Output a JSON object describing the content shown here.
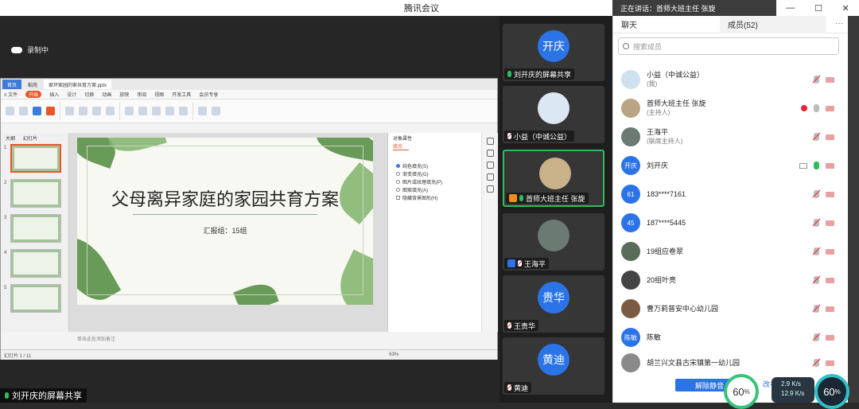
{
  "app_title": "腾讯会议",
  "recording": {
    "label": "录制中"
  },
  "share_label": "刘开庆的屏幕共享",
  "wps": {
    "tabs": [
      "首页",
      "稻壳",
      "家环家园的家共育方案.pptx"
    ],
    "menu": [
      "≡ 文件",
      "开始",
      "插入",
      "设计",
      "切换",
      "动画",
      "放映",
      "审阅",
      "视图",
      "开发工具",
      "会员专享"
    ],
    "outline_tabs": [
      "大纲",
      "幻灯片"
    ],
    "slide_title": "父母离异家庭的家园共育方案",
    "slide_sub": "汇报组：15组",
    "note_placeholder": "单击此处添加备注",
    "panel_title": "对象属性",
    "panel_tab": "填充",
    "panel_options": [
      "纯色填充(S)",
      "渐变填充(G)",
      "图片或纹理填充(P)",
      "图案填充(A)",
      "隐藏背景图形(H)"
    ],
    "status": "幻灯片 1 / 11",
    "zoom": "63%"
  },
  "video_tiles": [
    {
      "avatar_text": "开庆",
      "name": "刘开庆的屏幕共享",
      "mic": "on"
    },
    {
      "avatar_text": "",
      "name": "小益（中诚公益）",
      "mic": "muted"
    },
    {
      "avatar_text": "",
      "name": "首师大班主任 张旋",
      "mic": "on"
    },
    {
      "avatar_text": "",
      "name": "王海平",
      "mic": "muted"
    },
    {
      "avatar_text": "贵华",
      "name": "王贵华",
      "mic": "muted"
    },
    {
      "avatar_text": "黄迪",
      "name": "黄迪",
      "mic": "muted"
    }
  ],
  "speaking": "正在讲话：首师大班主任 张旋",
  "window_controls": [
    "—",
    "☐",
    "✕"
  ],
  "right_panel": {
    "tab_chat": "聊天",
    "tab_members": "成员(52)",
    "more": "···",
    "search_placeholder": "搜索成员",
    "members": [
      {
        "avatar": "",
        "name": "小益（中诚公益）",
        "role": "(我)"
      },
      {
        "avatar": "",
        "name": "首师大班主任 张旋",
        "role": "(主持人)"
      },
      {
        "avatar": "",
        "name": "王海平",
        "role": "(联席主持人)"
      },
      {
        "avatar": "开庆",
        "name": "刘开庆",
        "role": ""
      },
      {
        "avatar": "61",
        "name": "183****7161",
        "role": ""
      },
      {
        "avatar": "45",
        "name": "187****5445",
        "role": ""
      },
      {
        "avatar": "",
        "name": "19组应卷翠",
        "role": ""
      },
      {
        "avatar": "",
        "name": "20组叶亮",
        "role": ""
      },
      {
        "avatar": "",
        "name": "曹万莉普安中心幼儿园",
        "role": ""
      },
      {
        "avatar": "陈敏",
        "name": "陈敏",
        "role": ""
      },
      {
        "avatar": "",
        "name": "胡兰兴文县古宋镇第一幼儿园",
        "role": ""
      }
    ],
    "unmute_btn": "解除静音",
    "partial_btn": "改名"
  },
  "gauges": {
    "left": "60",
    "right": "60",
    "unit": "%"
  },
  "net": {
    "up": "2.9 K/s",
    "down": "12.9 K/s"
  }
}
